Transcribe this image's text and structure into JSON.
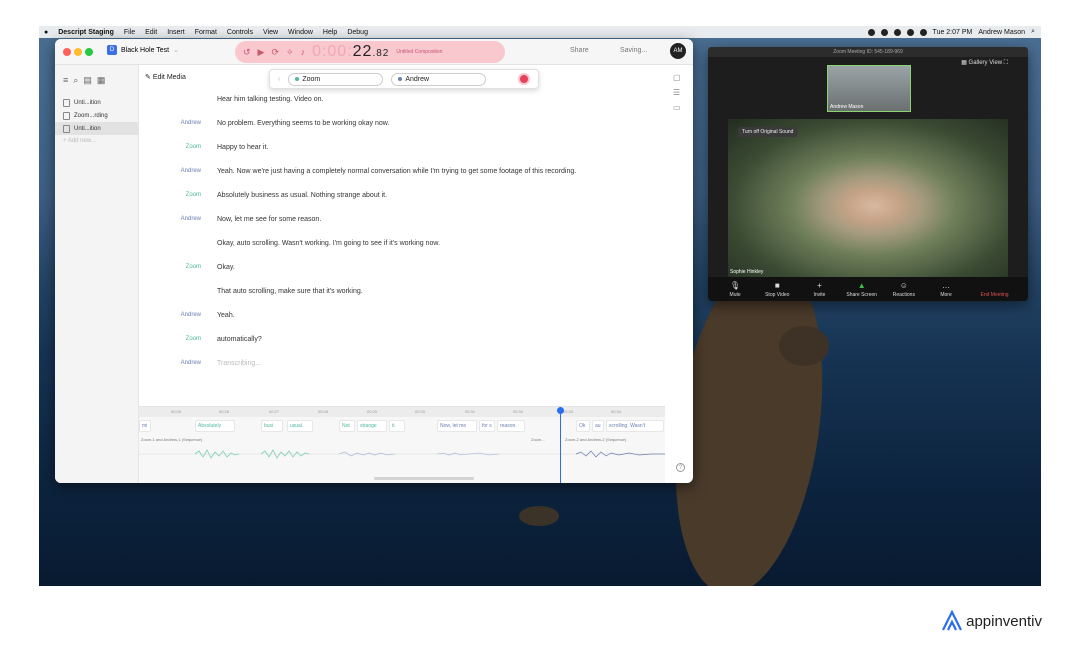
{
  "menubar": {
    "apple": "",
    "app": "Descript Staging",
    "menus": [
      "File",
      "Edit",
      "Insert",
      "Format",
      "Controls",
      "View",
      "Window",
      "Help",
      "Debug"
    ],
    "clock": "Tue 2:07 PM",
    "user": "Andrew Mason"
  },
  "descript": {
    "project": "Black Hole Test",
    "timer": {
      "dim": "0:00:",
      "main": "22",
      "frac": ".82"
    },
    "composition": "Untitled Composition",
    "share": "Share",
    "saving": "Saving...",
    "avatar": "AM",
    "files": [
      "Unti...ition",
      "Zoom...rding",
      "Unti...ition"
    ],
    "add_new": "Add new...",
    "edit_media": "Edit Media",
    "speakers": [
      "Zoom",
      "Andrew"
    ],
    "transcript": [
      {
        "speaker": "",
        "text": "Hear him talking testing. Video on."
      },
      {
        "speaker": "Andrew",
        "text": "No problem. Everything seems to be working okay now."
      },
      {
        "speaker": "Zoom",
        "text": "Happy to hear it."
      },
      {
        "speaker": "Andrew",
        "text": "Yeah. Now we're just having a completely normal conversation while I'm trying to get some footage of this recording."
      },
      {
        "speaker": "Zoom",
        "text": "Absolutely business as usual. Nothing strange about it."
      },
      {
        "speaker": "Andrew",
        "text": "Now, let me see for some reason."
      },
      {
        "speaker": "",
        "text": "Okay, auto scrolling. Wasn't working. I'm going to see if it's working now."
      },
      {
        "speaker": "Zoom",
        "text": "Okay."
      },
      {
        "speaker": "",
        "text": "That auto scrolling, make sure that it's working."
      },
      {
        "speaker": "Andrew",
        "text": "Yeah."
      },
      {
        "speaker": "Zoom",
        "text": "automatically?"
      },
      {
        "speaker": "Andrew",
        "text": "Transcribing..."
      }
    ],
    "ticks": [
      "00:05",
      "00:26",
      "00:27",
      "00:28",
      "00:29",
      "00:30",
      "00:31",
      "00:32",
      "00:33",
      "00:34"
    ],
    "timeline_words": [
      "mi",
      "Absolutely",
      "busi",
      "usual.",
      "Not",
      "strange",
      "it.",
      "Now, let me",
      "for s",
      "reason.",
      "Ok",
      "au",
      "scrolling. Wasn't"
    ],
    "sequences": [
      "Zoom-1 and Andrew-1 (Sequence)",
      "Zoom...",
      "Zoom-2 and Andrew-2 (Sequence)"
    ]
  },
  "zoom": {
    "title": "Zoom Meeting ID: 545-189-969",
    "gallery": "Gallery View",
    "thumb_name": "Andrew Mason",
    "main_name": "Sophie Hinkley",
    "sound_btn": "Turn off Original Sound",
    "controls": [
      "Mute",
      "Stop Video",
      "Invite",
      "Share Screen",
      "Reactions",
      "More"
    ],
    "end": "End Meeting"
  },
  "brand": {
    "name": "appinventiv"
  }
}
